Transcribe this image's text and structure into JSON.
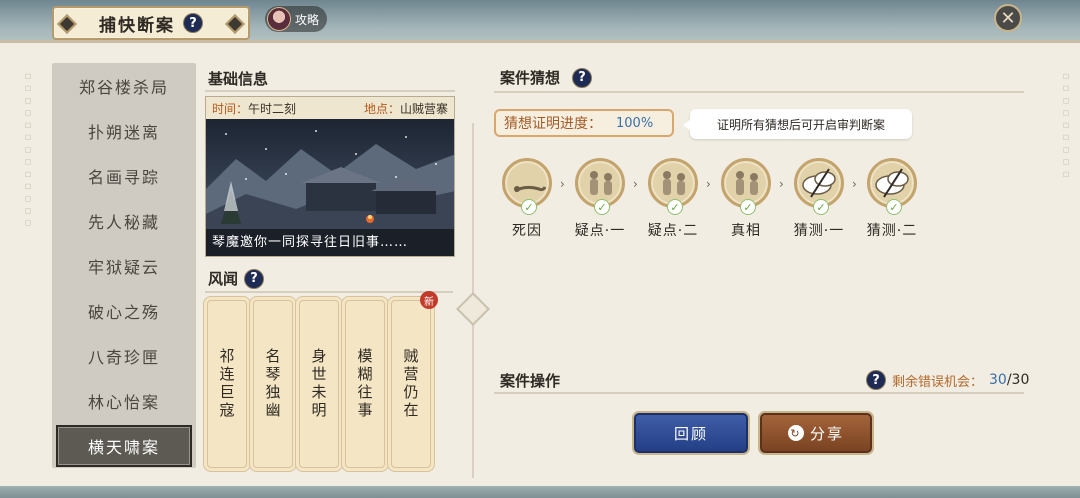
{
  "header": {
    "title": "捕快断案",
    "help_icon": "?",
    "guide_label": "攻略",
    "close_icon": "✕"
  },
  "case_list": {
    "items": [
      {
        "label": "郑谷楼杀局",
        "active": false
      },
      {
        "label": "扑朔迷离",
        "active": false
      },
      {
        "label": "名画寻踪",
        "active": false
      },
      {
        "label": "先人秘藏",
        "active": false
      },
      {
        "label": "牢狱疑云",
        "active": false
      },
      {
        "label": "破心之殇",
        "active": false
      },
      {
        "label": "八奇珍匣",
        "active": false
      },
      {
        "label": "林心怡案",
        "active": false
      },
      {
        "label": "横天啸案",
        "active": true
      }
    ]
  },
  "basic_info": {
    "title": "基础信息",
    "time_key": "时间：",
    "time_value": "午时二刻",
    "place_key": "地点：",
    "place_value": "山贼营寨",
    "caption": "琴魔邀你一同探寻往日旧事……"
  },
  "rumors": {
    "title": "风闻",
    "help_icon": "?",
    "new_badge": "新",
    "items": [
      {
        "label": "祁连巨寇",
        "is_new": false
      },
      {
        "label": "名琴独幽",
        "is_new": false
      },
      {
        "label": "身世未明",
        "is_new": false
      },
      {
        "label": "模糊往事",
        "is_new": false
      },
      {
        "label": "贼营仍在",
        "is_new": true
      }
    ]
  },
  "guess": {
    "title": "案件猜想",
    "help_icon": "?",
    "progress_label": "猜想证明进度：",
    "progress_value": "100%",
    "tip": "证明所有猜想后可开启审判断案",
    "check_icon": "✓",
    "arrow_icon": "›",
    "nodes": [
      {
        "label": "死因",
        "icon": "body-icon"
      },
      {
        "label": "疑点·一",
        "icon": "figures-icon"
      },
      {
        "label": "疑点·二",
        "icon": "figures-icon"
      },
      {
        "label": "真相",
        "icon": "figures-icon"
      },
      {
        "label": "猜测·一",
        "icon": "crossed-bubble-icon"
      },
      {
        "label": "猜测·二",
        "icon": "crossed-bubble-icon"
      }
    ]
  },
  "operations": {
    "title": "案件操作",
    "help_icon": "?",
    "mistake_label": "剩余错误机会：",
    "mistake_current": "30",
    "mistake_total": "/30",
    "review_label": "回顾",
    "share_label": "分享",
    "share_icon": "↻"
  },
  "colors": {
    "paper": "#f1ede3",
    "accent_blue": "#3a6fa8",
    "accent_orange": "#b46a2c",
    "review_button": "#2f4b96",
    "share_button": "#8a4f2c"
  }
}
